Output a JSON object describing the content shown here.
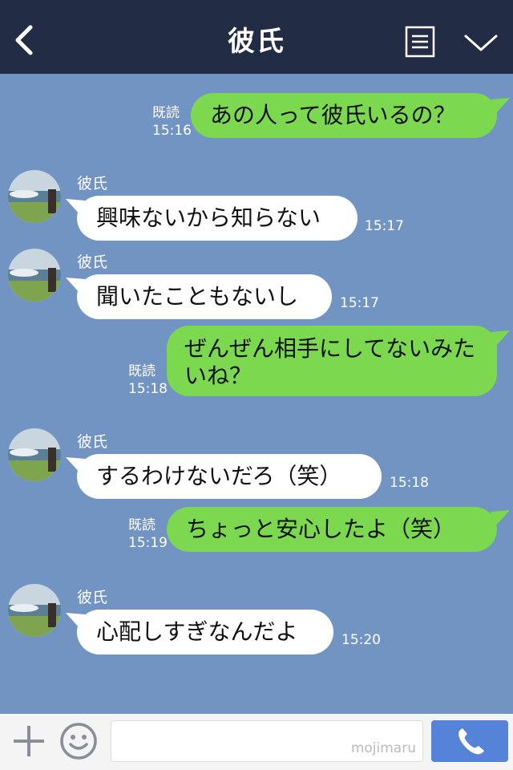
{
  "header": {
    "title": "彼氏",
    "back_icon": "back-arrow-icon",
    "note_icon": "note-icon",
    "menu_icon": "chevron-down-icon",
    "background": "#232c45"
  },
  "chat": {
    "background": "#7194c2",
    "read_label": "既読",
    "messages": [
      {
        "from": "me",
        "text": "あの人って彼氏いるの？",
        "time": "15:16",
        "read": true
      },
      {
        "from": "them",
        "sender": "彼氏",
        "text": "興味ないから知らない",
        "time": "15:17"
      },
      {
        "from": "them",
        "sender": "彼氏",
        "text": "聞いたこともないし",
        "time": "15:17"
      },
      {
        "from": "me",
        "text": "ぜんぜん相手にしてないみたいね？",
        "time": "15:18",
        "read": true
      },
      {
        "from": "them",
        "sender": "彼氏",
        "text": "するわけないだろ（笑）",
        "time": "15:18"
      },
      {
        "from": "me",
        "text": "ちょっと安心したよ（笑）",
        "time": "15:19",
        "read": true
      },
      {
        "from": "them",
        "sender": "彼氏",
        "text": "心配しすぎなんだよ",
        "time": "15:20"
      }
    ],
    "bubble_colors": {
      "incoming": "#ffffff",
      "outgoing": "#7bd84f"
    }
  },
  "footer": {
    "plus_icon": "plus-icon",
    "emoji_icon": "emoji-icon",
    "call_icon": "phone-icon",
    "input_value": "",
    "watermark": "mojimaru",
    "call_button_color": "#5583d8"
  }
}
